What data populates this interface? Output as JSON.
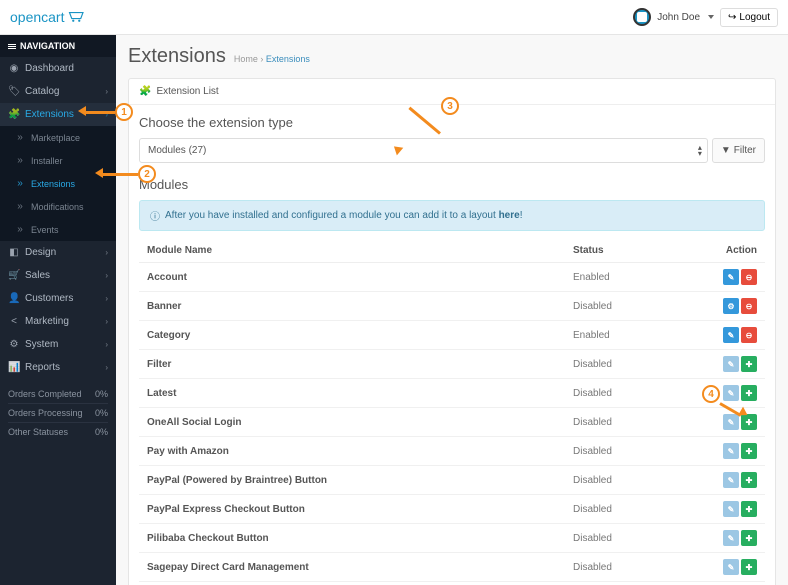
{
  "brand": "opencart",
  "user_name": "John Doe",
  "logout_label": "Logout",
  "nav_header": "NAVIGATION",
  "sidebar": {
    "items": [
      {
        "icon": "◉",
        "label": "Dashboard"
      },
      {
        "icon": "🏷",
        "label": "Catalog",
        "chev": "›"
      },
      {
        "icon": "🧩",
        "label": "Extensions",
        "chev": "›",
        "active": true
      },
      {
        "icon": "◧",
        "label": "Design",
        "chev": "›"
      },
      {
        "icon": "🛒",
        "label": "Sales",
        "chev": "›"
      },
      {
        "icon": "👤",
        "label": "Customers",
        "chev": "›"
      },
      {
        "icon": "<",
        "label": "Marketing",
        "chev": "›"
      },
      {
        "icon": "⚙",
        "label": "System",
        "chev": "›"
      },
      {
        "icon": "📊",
        "label": "Reports",
        "chev": "›"
      }
    ],
    "sub": [
      {
        "pre": "»",
        "label": "Marketplace"
      },
      {
        "pre": "»",
        "label": "Installer"
      },
      {
        "pre": "»",
        "label": "Extensions",
        "active": true
      },
      {
        "pre": "»",
        "label": "Modifications"
      },
      {
        "pre": "»",
        "label": "Events"
      }
    ]
  },
  "stats": [
    {
      "label": "Orders Completed",
      "value": "0%"
    },
    {
      "label": "Orders Processing",
      "value": "0%"
    },
    {
      "label": "Other Statuses",
      "value": "0%"
    }
  ],
  "page_title": "Extensions",
  "breadcrumb": {
    "home": "Home",
    "sep": "›",
    "current": "Extensions"
  },
  "panel_head": "Extension List",
  "choose_label": "Choose the extension type",
  "select_value": "Modules (27)",
  "filter_label": "Filter",
  "modules_heading": "Modules",
  "alert_text": "After you have installed and configured a module you can add it to a layout ",
  "alert_link": "here",
  "table": {
    "col_name": "Module Name",
    "col_status": "Status",
    "col_action": "Action"
  },
  "rows": [
    {
      "name": "Account",
      "status": "Enabled",
      "btns": [
        "edit",
        "del"
      ]
    },
    {
      "name": "Banner",
      "status": "Disabled",
      "btns": [
        "gear",
        "del"
      ]
    },
    {
      "name": "Category",
      "status": "Enabled",
      "btns": [
        "edit",
        "del"
      ]
    },
    {
      "name": "Filter",
      "status": "Disabled",
      "btns": [
        "edit-muted",
        "install"
      ]
    },
    {
      "name": "Latest",
      "status": "Disabled",
      "btns": [
        "edit-muted",
        "install"
      ]
    },
    {
      "name": "OneAll Social Login",
      "status": "Disabled",
      "btns": [
        "edit-muted",
        "install"
      ]
    },
    {
      "name": "Pay with Amazon",
      "status": "Disabled",
      "btns": [
        "edit-muted",
        "install"
      ]
    },
    {
      "name": "PayPal (Powered by Braintree) Button",
      "status": "Disabled",
      "btns": [
        "edit-muted",
        "install"
      ]
    },
    {
      "name": "PayPal Express Checkout Button",
      "status": "Disabled",
      "btns": [
        "edit-muted",
        "install"
      ]
    },
    {
      "name": "Pilibaba Checkout Button",
      "status": "Disabled",
      "btns": [
        "edit-muted",
        "install"
      ]
    },
    {
      "name": "Sagepay Direct Card Management",
      "status": "Disabled",
      "btns": [
        "edit-muted",
        "install"
      ]
    }
  ]
}
